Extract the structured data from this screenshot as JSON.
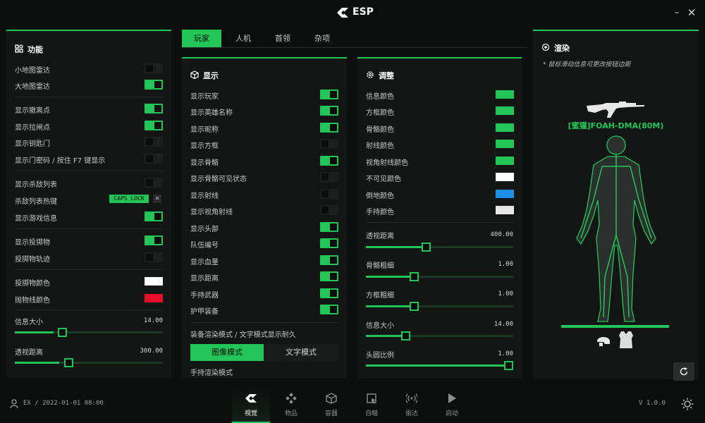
{
  "title": "ESP",
  "window": {
    "minimize": "–",
    "close": "✕"
  },
  "tabs": [
    "玩家",
    "人机",
    "首领",
    "杂项"
  ],
  "func": {
    "header": "功能",
    "toggles": [
      {
        "label": "小地图雷达",
        "on": false
      },
      {
        "label": "大地图雷达",
        "on": true
      },
      {
        "label": "显示撤离点",
        "on": true
      },
      {
        "label": "显示拉闸点",
        "on": true
      },
      {
        "label": "显示钥匙门",
        "on": false
      },
      {
        "label": "显示门密码 / 按住 F7 键显示",
        "on": false
      },
      {
        "label": "显示杀敌列表",
        "on": false
      },
      {
        "label": "杀敌列表热键",
        "key": "CAPS LOCK",
        "clear": "✕"
      },
      {
        "label": "显示游戏信息",
        "on": true
      },
      {
        "label": "显示投掷物",
        "on": true
      },
      {
        "label": "投掷物轨迹",
        "on": false
      }
    ],
    "colors": [
      {
        "label": "投掷物颜色",
        "color": "#ffffff"
      },
      {
        "label": "抛物线颜色",
        "color": "#e4102a"
      }
    ],
    "sliders": [
      {
        "label": "信息大小",
        "value": "14.00",
        "fraction": 0.25
      },
      {
        "label": "透视距离",
        "value": "300.00",
        "fraction": 0.3
      }
    ]
  },
  "display": {
    "header": "显示",
    "toggles": [
      {
        "label": "显示玩家",
        "on": true
      },
      {
        "label": "显示英雄名称",
        "on": true
      },
      {
        "label": "显示昵称",
        "on": true
      },
      {
        "label": "显示方框",
        "on": false
      },
      {
        "label": "显示骨骼",
        "on": true
      },
      {
        "label": "显示骨骼可见状态",
        "on": false
      },
      {
        "label": "显示射线",
        "on": false
      },
      {
        "label": "显示视角射线",
        "on": false
      },
      {
        "label": "显示头部",
        "on": true
      },
      {
        "label": "队伍编号",
        "on": true
      },
      {
        "label": "显示血量",
        "on": true
      },
      {
        "label": "显示距离",
        "on": true
      },
      {
        "label": "手持武器",
        "on": true
      },
      {
        "label": "护甲装备",
        "on": true
      }
    ],
    "equip_mode_label": "装备渲染模式 / 文字模式显示耐久",
    "mode_image": "图像模式",
    "mode_text": "文字模式",
    "weapon_mode_label": "手持渲染模式"
  },
  "adjust": {
    "header": "调整",
    "colors": [
      {
        "label": "信息颜色",
        "color": "#22c656"
      },
      {
        "label": "方框颜色",
        "color": "#22c656"
      },
      {
        "label": "骨骼颜色",
        "color": "#22c656"
      },
      {
        "label": "射线颜色",
        "color": "#22c656"
      },
      {
        "label": "视角射线颜色",
        "color": "#22c656"
      },
      {
        "label": "不可见颜色",
        "color": "#ffffff"
      },
      {
        "label": "倒地颜色",
        "color": "#1e8fe6"
      },
      {
        "label": "手持颜色",
        "color": "#e6e6e6"
      }
    ],
    "sliders": [
      {
        "label": "透视距离",
        "value": "400.00",
        "fraction": 0.41
      },
      {
        "label": "骨骼粗细",
        "value": "1.00",
        "fraction": 0.33
      },
      {
        "label": "方框粗细",
        "value": "1.00",
        "fraction": 0.33
      },
      {
        "label": "信息大小",
        "value": "14.00",
        "fraction": 0.27
      },
      {
        "label": "头圆比例",
        "value": "1.00",
        "fraction": 1.0
      }
    ]
  },
  "render": {
    "header": "渲染",
    "hint": "* 鼠标滑动信息可更改按钮边距",
    "player_tag": "[蜜獾]FOAH-DMA(80M)"
  },
  "bottom": {
    "user": "EX / 2022-01-01 08:00",
    "nav": [
      {
        "label": "视觉",
        "active": true,
        "icon": "eye-icon"
      },
      {
        "label": "物品",
        "active": false,
        "icon": "items-icon"
      },
      {
        "label": "容器",
        "active": false,
        "icon": "box-icon"
      },
      {
        "label": "自瞄",
        "active": false,
        "icon": "aim-icon"
      },
      {
        "label": "雷达",
        "active": false,
        "icon": "radar-icon"
      },
      {
        "label": "启动",
        "active": false,
        "icon": "play-icon"
      }
    ],
    "version": "V 1.0.0"
  },
  "accent": "#22c656"
}
